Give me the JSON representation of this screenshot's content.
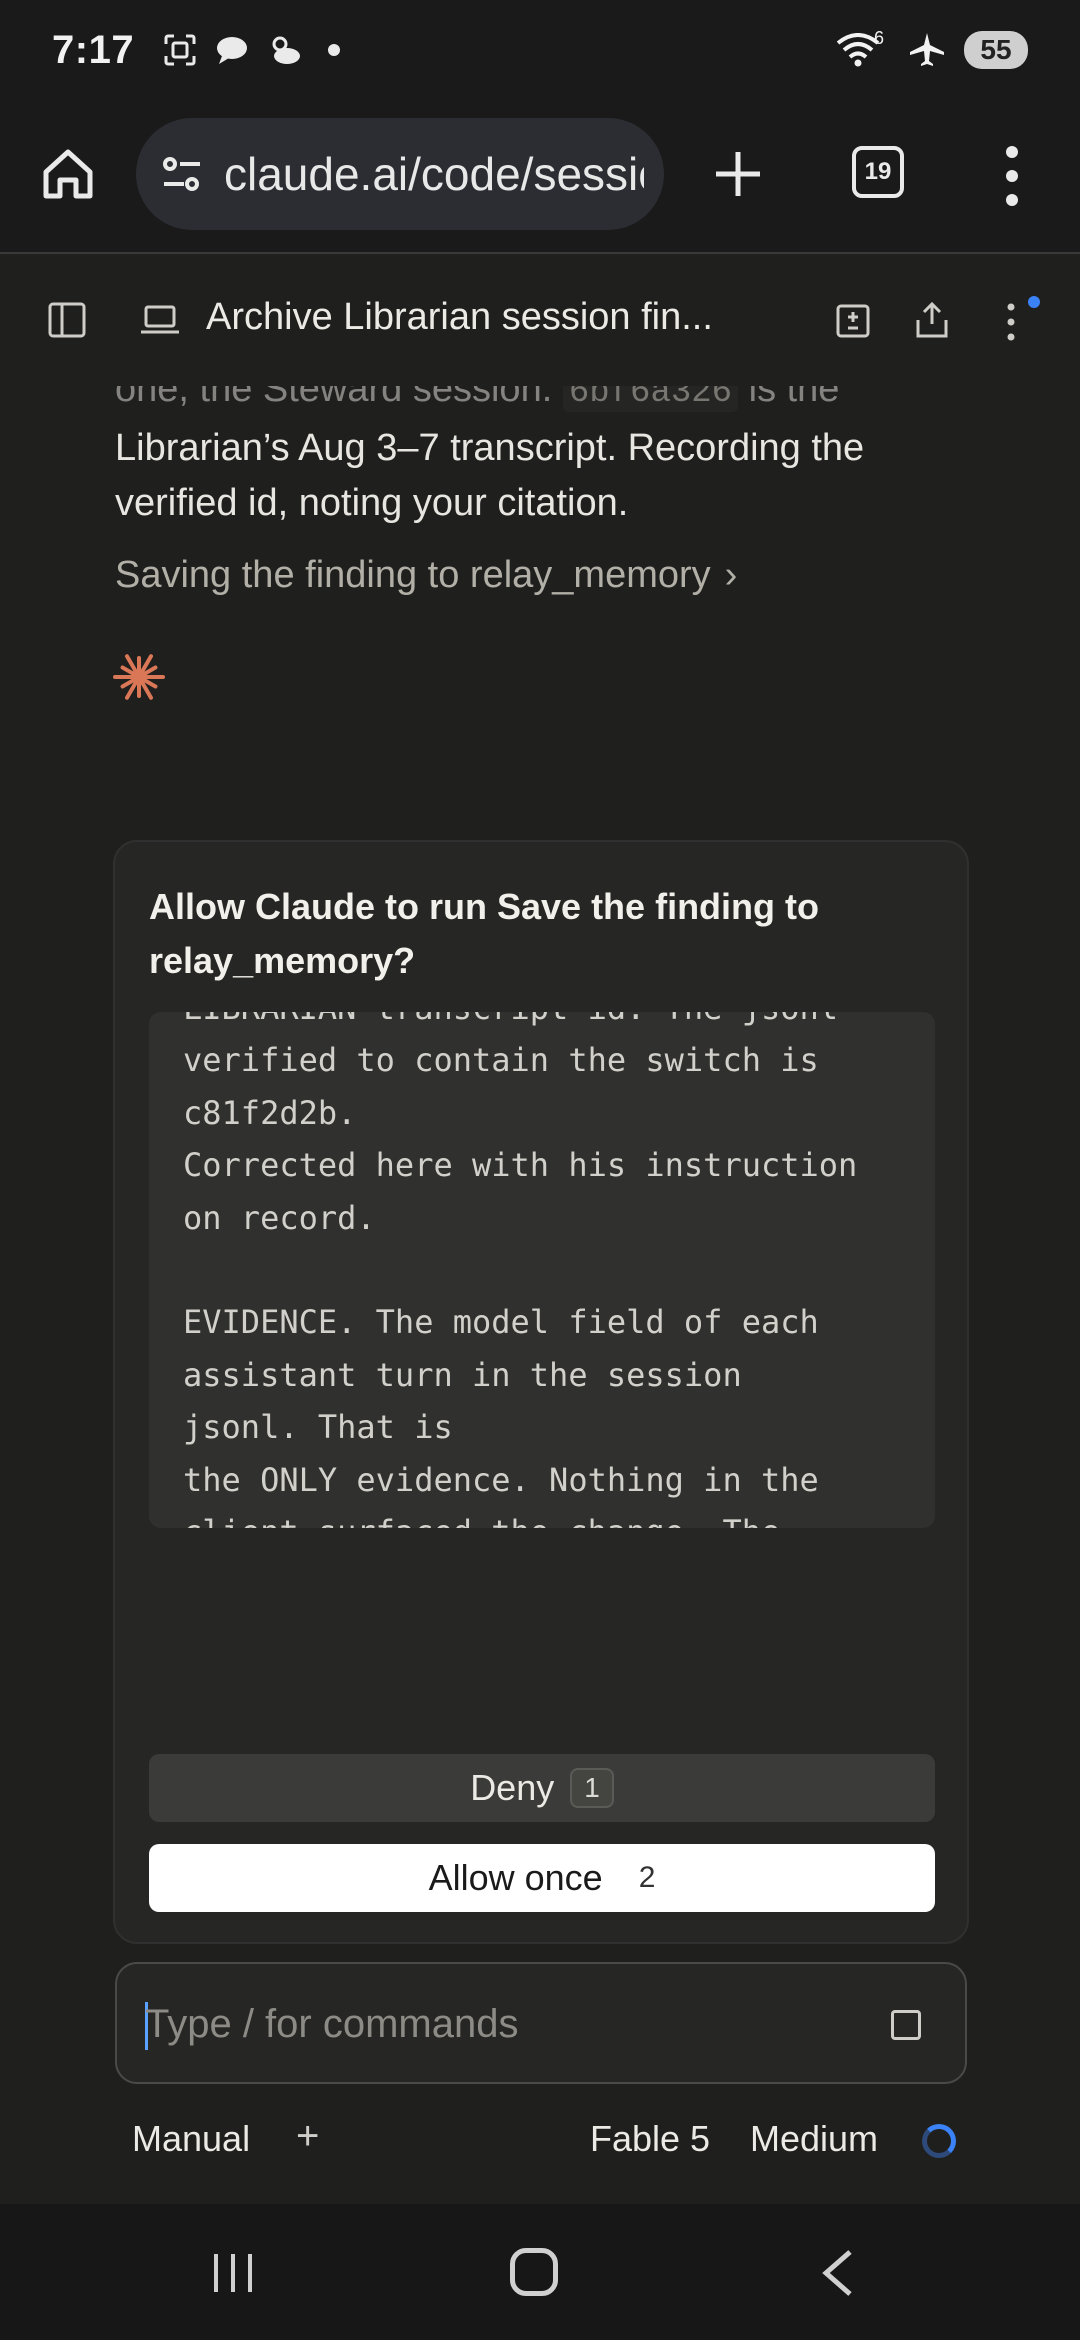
{
  "status_bar": {
    "time": "7:17",
    "wifi_label": "6",
    "battery": "55",
    "icons": [
      "screenshot-icon",
      "chat-bubble-icon",
      "weather-icon",
      "wifi-icon",
      "airplane-icon",
      "battery-icon"
    ]
  },
  "browser": {
    "url": "claude.ai/code/session",
    "tab_count": "19"
  },
  "header": {
    "session_title": "Archive Librarian session fin..."
  },
  "conversation": {
    "line1_prefix": "one, the Steward session. ",
    "line1_code": "6bf6a326",
    "line1_suffix": " is the",
    "line2": "Librarian’s Aug 3–7 transcript. Recording the",
    "line3": "verified id, noting your citation.",
    "tool_call": "Saving the finding to relay_memory",
    "tool_chevron": "›"
  },
  "permission": {
    "title": "Allow Claude to run Save the finding to relay_memory?",
    "content": "LIBRARIAN transcript id. The jsonl\nverified to contain the switch is\nc81f2d2b.\nCorrected here with his instruction\non record.\n\nEVIDENCE. The model field of each\nassistant turn in the session\njsonl. That is\nthe ONLY evidence. Nothing in the\nclient surfaced the change. The\nrunning\ninstance did not and could not\nperceive it; asked \"when did you",
    "deny_label": "Deny",
    "deny_key": "1",
    "allow_label": "Allow once",
    "allow_key": "2"
  },
  "composer": {
    "placeholder": "Type / for commands",
    "value": ""
  },
  "controls": {
    "mode": "Manual",
    "add": "+",
    "model": "Fable 5",
    "effort": "Medium"
  },
  "colors": {
    "accent_orange": "#d97757",
    "link_blue": "#3b82f6",
    "background": "#1f1f1e"
  }
}
